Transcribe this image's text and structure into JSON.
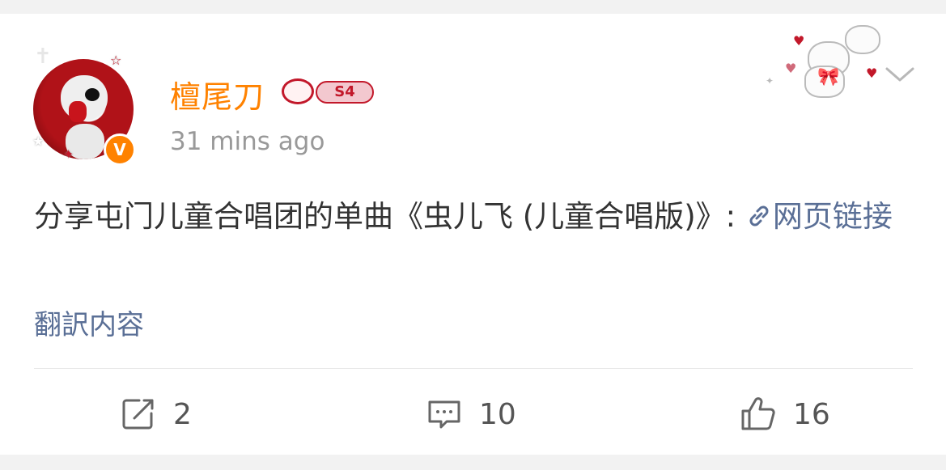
{
  "post": {
    "author": {
      "name": "檀尾刀",
      "level_badge": "S4",
      "verified_mark": "V",
      "avatar_icon": "avatar-icon"
    },
    "timestamp": "31 mins ago",
    "content": {
      "text": "分享屯门儿童合唱团的单曲《虫儿飞 (儿童合唱版)》:",
      "link_label": "网页链接"
    },
    "translate_label": "翻訳内容"
  },
  "actions": {
    "repost": {
      "icon": "repost-icon",
      "count": "2"
    },
    "comment": {
      "icon": "comment-icon",
      "count": "10"
    },
    "like": {
      "icon": "like-icon",
      "count": "16"
    }
  },
  "colors": {
    "accent": "#ff8200",
    "link": "#5a6f96",
    "text": "#333333",
    "muted": "#999999",
    "badge": "#c2182a"
  }
}
